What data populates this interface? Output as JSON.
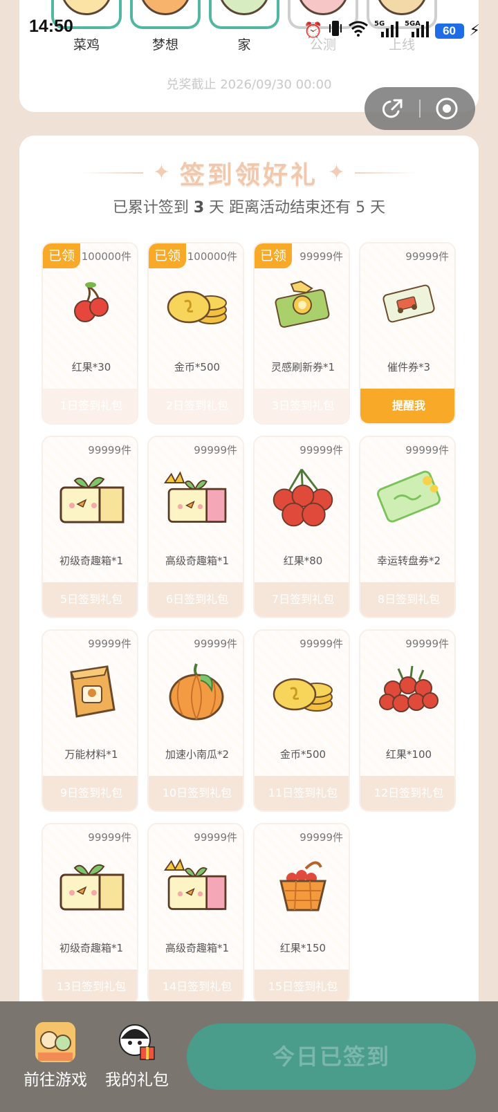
{
  "status_bar": {
    "time": "14:50",
    "network_labels": [
      "5G",
      "5GA"
    ],
    "battery": "60",
    "icons": [
      "alarm-icon",
      "vibrate-icon",
      "wifi-icon",
      "signal-icon",
      "signal-icon",
      "battery-icon",
      "charging-icon"
    ]
  },
  "milestones": [
    {
      "label": "菜鸡",
      "locked": false
    },
    {
      "label": "梦想",
      "locked": false
    },
    {
      "label": "家",
      "locked": false
    },
    {
      "label": "公测",
      "locked": true
    },
    {
      "label": "上线",
      "locked": true
    }
  ],
  "redeem_deadline": "兑奖截止 2026/09/30 00:00",
  "capsule": {
    "share_icon": "share-icon",
    "close_icon": "record-icon"
  },
  "sign_section": {
    "title": "签到领好礼",
    "sub_prefix": "已累计签到 ",
    "days_signed": "3",
    "sub_middle": " 天  距离活动结束还有 ",
    "days_left": "5",
    "sub_suffix": " 天"
  },
  "gifts": [
    {
      "qty": "100000件",
      "name": "红果*30",
      "day": "1日签到礼包",
      "claimed": true,
      "claimed_label": "已领",
      "icon": "red-fruit-icon"
    },
    {
      "qty": "100000件",
      "name": "金币*500",
      "day": "2日签到礼包",
      "claimed": true,
      "claimed_label": "已领",
      "icon": "gold-coin-icon"
    },
    {
      "qty": "99999件",
      "name": "灵感刷新券*1",
      "day": "3日签到礼包",
      "claimed": true,
      "claimed_label": "已领",
      "icon": "inspiration-ticket-icon"
    },
    {
      "qty": "99999件",
      "name": "催件券*3",
      "day": "提醒我",
      "claimed": false,
      "remind": true,
      "icon": "delivery-ticket-icon"
    },
    {
      "qty": "99999件",
      "name": "初级奇趣箱*1",
      "day": "5日签到礼包",
      "claimed": false,
      "icon": "basic-box-icon"
    },
    {
      "qty": "99999件",
      "name": "高级奇趣箱*1",
      "day": "6日签到礼包",
      "claimed": false,
      "icon": "premium-box-icon"
    },
    {
      "qty": "99999件",
      "name": "红果*80",
      "day": "7日签到礼包",
      "claimed": false,
      "icon": "red-fruit-bunch-icon"
    },
    {
      "qty": "99999件",
      "name": "幸运转盘券*2",
      "day": "8日签到礼包",
      "claimed": false,
      "icon": "lucky-wheel-ticket-icon"
    },
    {
      "qty": "99999件",
      "name": "万能材料*1",
      "day": "9日签到礼包",
      "claimed": false,
      "icon": "material-bag-icon"
    },
    {
      "qty": "99999件",
      "name": "加速小南瓜*2",
      "day": "10日签到礼包",
      "claimed": false,
      "icon": "pumpkin-icon"
    },
    {
      "qty": "99999件",
      "name": "金币*500",
      "day": "11日签到礼包",
      "claimed": false,
      "icon": "gold-coin-icon"
    },
    {
      "qty": "99999件",
      "name": "红果*100",
      "day": "12日签到礼包",
      "claimed": false,
      "icon": "red-fruit-pile-icon"
    },
    {
      "qty": "99999件",
      "name": "初级奇趣箱*1",
      "day": "13日签到礼包",
      "claimed": false,
      "icon": "basic-box-icon"
    },
    {
      "qty": "99999件",
      "name": "高级奇趣箱*1",
      "day": "14日签到礼包",
      "claimed": false,
      "icon": "premium-box-icon"
    },
    {
      "qty": "99999件",
      "name": "红果*150",
      "day": "15日签到礼包",
      "claimed": false,
      "icon": "fruit-basket-icon"
    }
  ],
  "bottom": {
    "go_game": "前往游戏",
    "my_gifts": "我的礼包",
    "signed_button": "今日已签到"
  },
  "colors": {
    "accent_teal": "#52b6a2",
    "claimed_orange": "#f8a928",
    "page_bg": "#f0e1d6"
  }
}
